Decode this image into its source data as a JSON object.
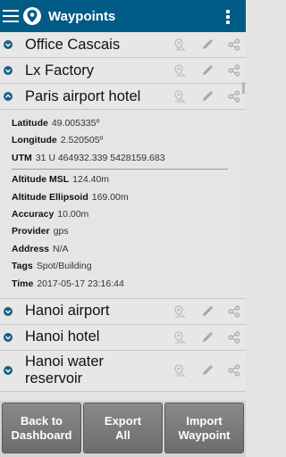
{
  "app": {
    "title": "Waypoints"
  },
  "waypoints": [
    {
      "name": "Office Cascais"
    },
    {
      "name": "Lx Factory"
    },
    {
      "name": "Paris airport hotel"
    },
    {
      "name": "Hanoi airport"
    },
    {
      "name": "Hanoi hotel"
    },
    {
      "name": "Hanoi water\nreservoir"
    }
  ],
  "details": {
    "latitude": {
      "label": "Latitude",
      "value": "49.005335º"
    },
    "longitude": {
      "label": "Longitude",
      "value": "2.520505º"
    },
    "utm": {
      "label": "UTM",
      "value": "31 U 464932.339 5428159.683"
    },
    "altitude_msl": {
      "label": "Altitude MSL",
      "value": "124.40m"
    },
    "altitude_ellipsoid": {
      "label": "Altitude Ellipsoid",
      "value": "169.00m"
    },
    "accuracy": {
      "label": "Accuracy",
      "value": "10.00m"
    },
    "provider": {
      "label": "Provider",
      "value": "gps"
    },
    "address": {
      "label": "Address",
      "value": "N/A"
    },
    "tags": {
      "label": "Tags",
      "value": "Spot/Building"
    },
    "time": {
      "label": "Time",
      "value": "2017-05-17 23:16:44"
    }
  },
  "buttons": {
    "back": "Back to\nDashboard",
    "export": "Export\nAll",
    "import": "Import\nWaypoint"
  },
  "colors": {
    "appbar": "#005b86",
    "button": "#7a7a7a"
  }
}
